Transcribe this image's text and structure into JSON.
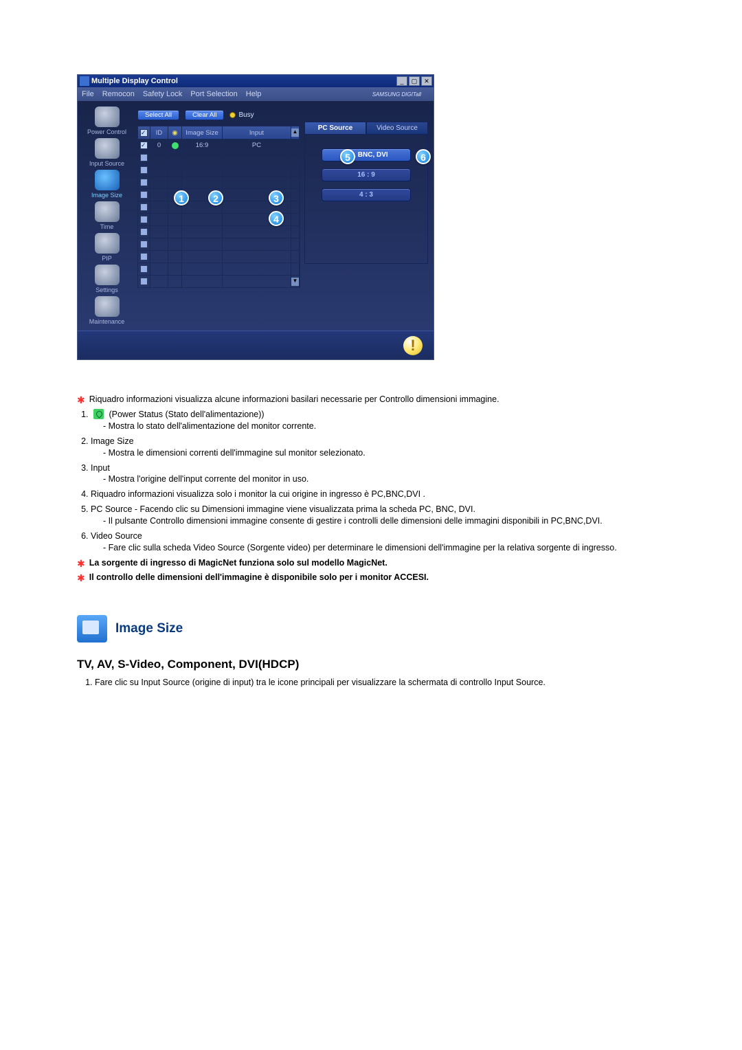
{
  "window": {
    "title": "Multiple Display Control",
    "brand": "SAMSUNG DIGITall"
  },
  "menu": [
    "File",
    "Remocon",
    "Safety Lock",
    "Port Selection",
    "Help"
  ],
  "sidebar": [
    "Power Control",
    "Input Source",
    "Image Size",
    "Time",
    "PIP",
    "Settings",
    "Maintenance"
  ],
  "topButtons": {
    "selectAll": "Select All",
    "clearAll": "Clear All",
    "busy": "Busy"
  },
  "gridHeaders": {
    "id": "ID",
    "imageSize": "Image Size",
    "input": "Input"
  },
  "gridRow0": {
    "id": "0",
    "imageSize": "16:9",
    "input": "PC"
  },
  "tabs": {
    "pcSource": "PC Source",
    "videoSource": "Video Source"
  },
  "pills": {
    "header": "PC, BNC, DVI",
    "opt1": "16 : 9",
    "opt2": "4 : 3"
  },
  "markers": {
    "m1": "1",
    "m2": "2",
    "m3": "3",
    "m4": "4",
    "m5": "5",
    "m6": "6"
  },
  "notes": {
    "n_star_intro": "Riquadro informazioni visualizza alcune informazioni basilari necessarie per Controllo dimensioni immagine.",
    "n1_lead": "(Power Status (Stato dell'alimentazione))",
    "n1_sub": "Mostra lo stato dell'alimentazione del monitor corrente.",
    "n2_lead": "Image Size",
    "n2_sub": "Mostra le dimensioni correnti dell'immagine sul monitor selezionato.",
    "n3_lead": "Input",
    "n3_sub": "Mostra l'origine dell'input corrente del monitor in uso.",
    "n4": "Riquadro informazioni visualizza solo i monitor la cui origine in ingresso è PC,BNC,DVI .",
    "n5_lead": "PC Source - Facendo clic su Dimensioni immagine viene visualizzata prima la scheda PC, BNC, DVI.",
    "n5_sub": "Il pulsante Controllo dimensioni immagine consente di gestire i controlli delle dimensioni delle immagini disponibili in PC,BNC,DVI.",
    "n6_lead": "Video Source",
    "n6_sub": "Fare clic sulla scheda Video Source (Sorgente video) per determinare le dimensioni dell'immagine per la relativa sorgente di ingresso.",
    "n_star_bold1": "La sorgente di ingresso di MagicNet funziona solo sul modello MagicNet.",
    "n_star_bold2": "Il controllo delle dimensioni dell'immagine è disponibile solo per i monitor ACCESI."
  },
  "section2": {
    "title": "Image Size",
    "subtitle": "TV, AV, S-Video, Component, DVI(HDCP)",
    "item1": "Fare clic su Input Source (origine di input) tra le icone principali per visualizzare la schermata di controllo Input Source."
  }
}
